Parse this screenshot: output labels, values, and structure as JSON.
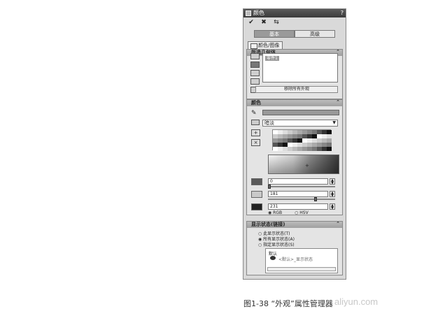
{
  "panel": {
    "title": "颜色",
    "help": "?",
    "tabs": [
      "基本",
      "高级"
    ],
    "subtab": "颜色/图像"
  },
  "geometry": {
    "header": "所选几何体",
    "list_item": "零件1",
    "remove_button": "移除所有外观"
  },
  "color": {
    "header": "颜色",
    "select": "暗淡",
    "values": [
      "0",
      "181",
      "231"
    ],
    "swatches": [
      "#5a5a5a",
      "#c9c9c9",
      "#222222"
    ],
    "modes": [
      "RGB",
      "HSV"
    ]
  },
  "display": {
    "header": "显示状态(链接)",
    "options": [
      "此显示状态(T)",
      "所有显示状态(A)",
      "指定显示状态(S)"
    ],
    "list_items": [
      "默认",
      "<默认>_显示状态"
    ]
  },
  "caption": "图1-38 “外观”属性管理器",
  "watermark": "aliyun.com"
}
